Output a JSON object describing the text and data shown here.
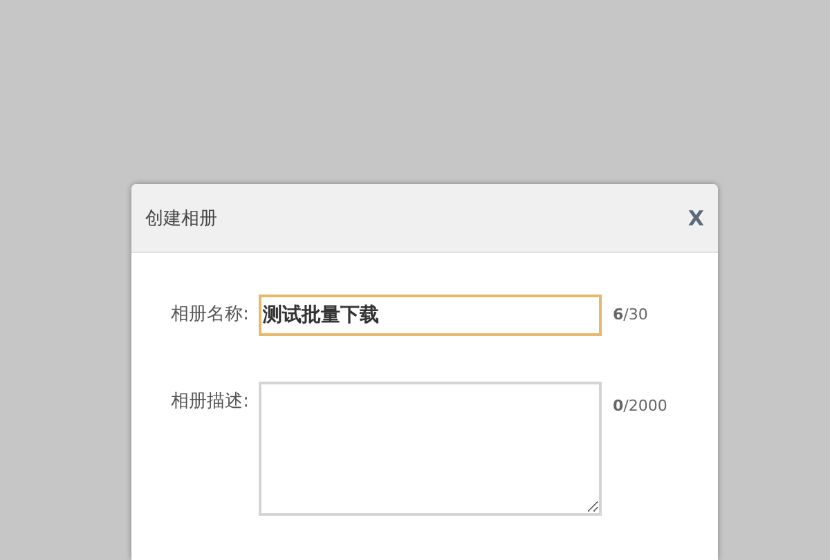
{
  "dialog": {
    "title": "创建相册",
    "close": "X",
    "fields": [
      {
        "kind": "input",
        "label": "相册名称:",
        "value": "测试批量下载",
        "focused": true,
        "counter": "**6**/30"
      },
      {
        "kind": "textarea",
        "label": "相册描述:",
        "focused": false,
        "counter": "**0**/2000"
      }
    ]
  }
}
